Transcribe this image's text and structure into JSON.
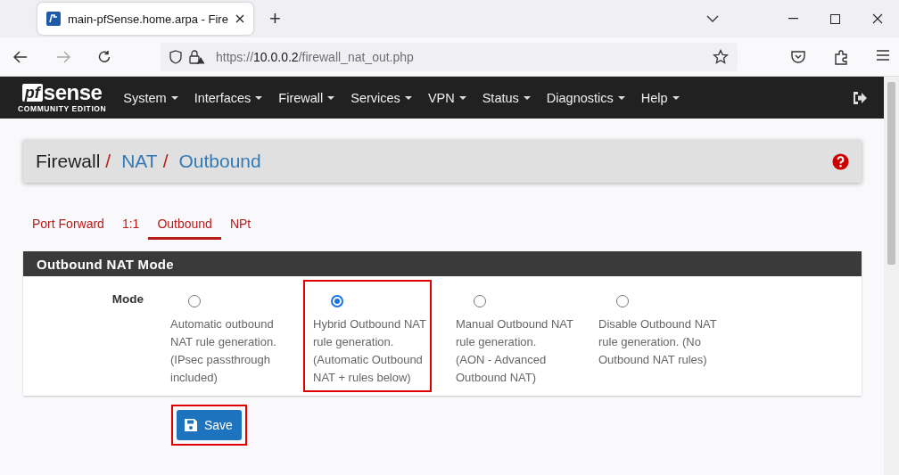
{
  "browser": {
    "tab_title": "main-pfSense.home.arpa - Fire",
    "url_scheme": "https://",
    "url_host": "10.0.0.2",
    "url_path": "/firewall_nat_out.php",
    "new_tab": "+"
  },
  "navbar": {
    "logo_mark": "pf",
    "logo_word": "sense",
    "logo_edition": "COMMUNITY EDITION",
    "menus": [
      "System",
      "Interfaces",
      "Firewall",
      "Services",
      "VPN",
      "Status",
      "Diagnostics",
      "Help"
    ]
  },
  "breadcrumb": [
    {
      "label": "Firewall",
      "link": false,
      "separator": "/"
    },
    {
      "label": "NAT",
      "link": true,
      "separator": "/"
    },
    {
      "label": "Outbound",
      "link": true
    }
  ],
  "tabs": [
    {
      "label": "Port Forward",
      "selected": false
    },
    {
      "label": "1:1",
      "selected": false
    },
    {
      "label": "Outbound",
      "selected": true
    },
    {
      "label": "NPt",
      "selected": false
    }
  ],
  "panel": {
    "title": "Outbound NAT Mode",
    "field_label": "Mode",
    "options": [
      {
        "text": "Automatic outbound NAT rule generation. (IPsec passthrough included)",
        "selected": false,
        "highlighted": false
      },
      {
        "text": "Hybrid Outbound NAT rule generation. (Automatic Outbound NAT + rules below)",
        "selected": true,
        "highlighted": true
      },
      {
        "text": "Manual Outbound NAT rule generation. (AON - Advanced Outbound NAT)",
        "selected": false,
        "highlighted": false
      },
      {
        "text": "Disable Outbound NAT rule generation. (No Outbound NAT rules)",
        "selected": false,
        "highlighted": false
      }
    ]
  },
  "save_button": {
    "label": "Save",
    "highlighted": true
  }
}
